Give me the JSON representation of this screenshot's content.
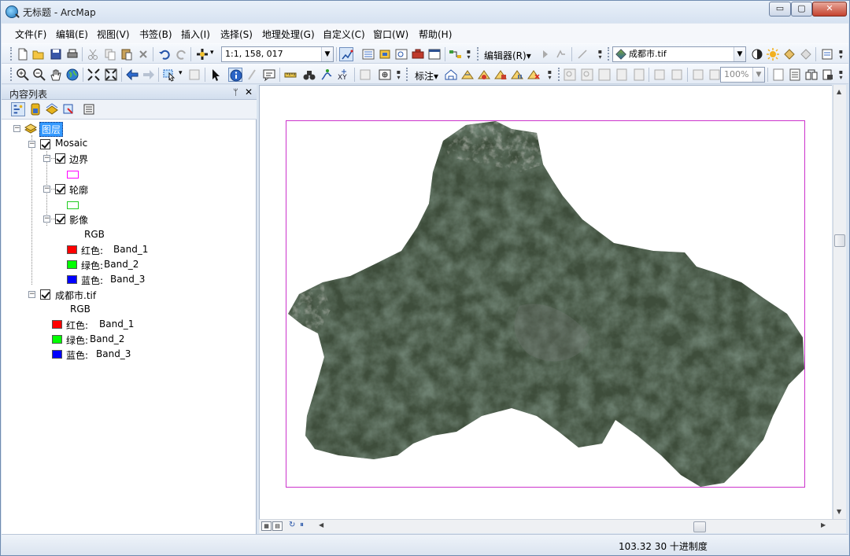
{
  "window": {
    "title": "无标题 - ArcMap",
    "minimize": "▭",
    "maximize": "▢",
    "close": "✕"
  },
  "menu": {
    "items": [
      "文件(F)",
      "编辑(E)",
      "视图(V)",
      "书签(B)",
      "插入(I)",
      "选择(S)",
      "地理处理(G)",
      "自定义(C)",
      "窗口(W)",
      "帮助(H)"
    ]
  },
  "toolbar": {
    "scale_value": "1:1, 158, 017",
    "editor_label": "编辑器(R)▾",
    "layer_combo_value": "成都市.tif",
    "label_menu": "标注▾",
    "zoom_percent": "100%"
  },
  "toc": {
    "title": "内容列表",
    "pin": "ᛘ",
    "close": "✕",
    "root_label": "图层",
    "mosaic": {
      "label": "Mosaic",
      "boundary_label": "边界",
      "outline_label": "轮廓",
      "image_label": "影像",
      "rgb_label": "RGB",
      "bands": [
        {
          "label": "红色:",
          "band": "Band_1",
          "color": "#ff0000"
        },
        {
          "label": "绿色:",
          "band": "Band_2",
          "color": "#00ff00"
        },
        {
          "label": "蓝色:",
          "band": "Band_3",
          "color": "#0000ff"
        }
      ],
      "boundary_color": "#ff00ff",
      "outline_color": "#00cc00"
    },
    "raster": {
      "label": "成都市.tif",
      "rgb_label": "RGB",
      "bands": [
        {
          "label": "红色:",
          "band": "Band_1",
          "color": "#ff0000"
        },
        {
          "label": "绿色:",
          "band": "Band_2",
          "color": "#00ff00"
        },
        {
          "label": "蓝色:",
          "band": "Band_3",
          "color": "#0000ff"
        }
      ]
    }
  },
  "map": {
    "frame_color": "#cc33cc",
    "imagery_color": "#3b4a38"
  },
  "status": {
    "coords": "103.32  30 十进制度"
  }
}
